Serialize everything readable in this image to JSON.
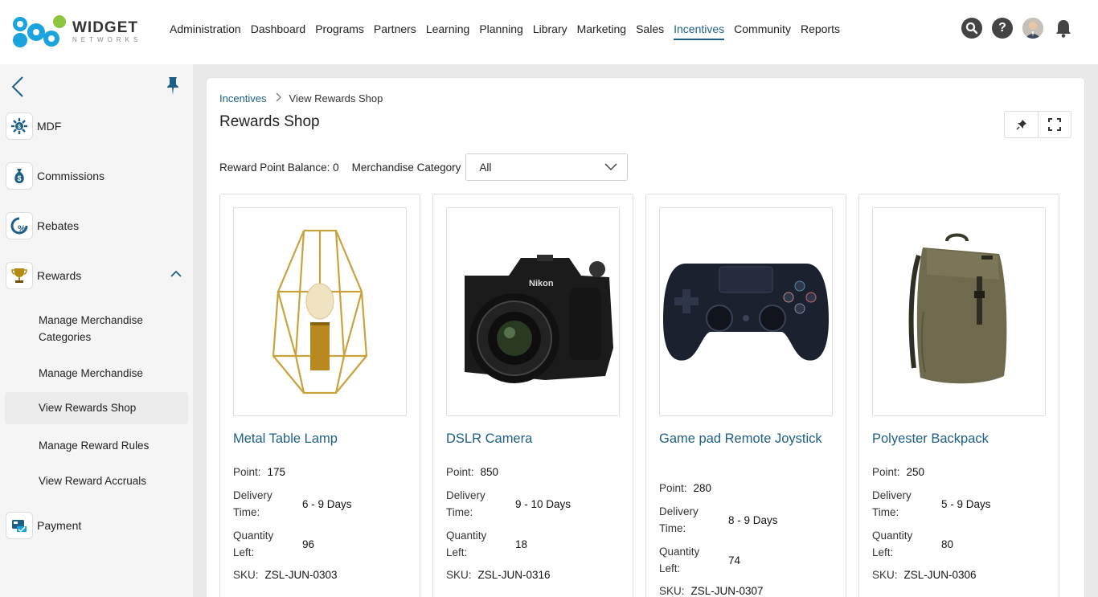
{
  "app": {
    "logo_word": "WIDGET",
    "logo_sub": "NETWORKS",
    "brand_colors": {
      "blue": "#1aa3dd",
      "green": "#8cc63f",
      "accent": "#1d5f85"
    }
  },
  "nav": {
    "items": [
      {
        "label": "Administration"
      },
      {
        "label": "Dashboard"
      },
      {
        "label": "Programs"
      },
      {
        "label": "Partners"
      },
      {
        "label": "Learning"
      },
      {
        "label": "Planning"
      },
      {
        "label": "Library"
      },
      {
        "label": "Marketing"
      },
      {
        "label": "Sales"
      },
      {
        "label": "Incentives",
        "active": true
      },
      {
        "label": "Community"
      },
      {
        "label": "Reports"
      }
    ],
    "icons": [
      "search-icon",
      "help-icon",
      "avatar",
      "bell-icon"
    ]
  },
  "sidebar": {
    "items": [
      {
        "label": "MDF",
        "icon": "mdf-icon"
      },
      {
        "label": "Commissions",
        "icon": "money-bag-icon"
      },
      {
        "label": "Rebates",
        "icon": "percent-icon"
      },
      {
        "label": "Rewards",
        "icon": "trophy-icon",
        "expanded": true
      },
      {
        "label": "Payment",
        "icon": "payment-icon"
      }
    ],
    "subitems": [
      {
        "label": "Manage Merchandise Categories"
      },
      {
        "label": "Manage Merchandise"
      },
      {
        "label": "View Rewards Shop",
        "active": true
      },
      {
        "label": "Manage Reward Rules"
      },
      {
        "label": "View Reward Accruals"
      }
    ]
  },
  "main": {
    "breadcrumb": {
      "link": "Incentives",
      "current": "View Rewards Shop"
    },
    "title": "Rewards Shop",
    "balance_label": "Reward Point Balance: 0",
    "category_label": "Merchandise Category",
    "category_value": "All",
    "field_labels": {
      "point": "Point:",
      "delivery_1": "Delivery",
      "delivery_2": "Time:",
      "quantity_1": "Quantity",
      "quantity_2": "Left:",
      "sku": "SKU:"
    },
    "products": [
      {
        "name": "Metal Table Lamp",
        "point": "175",
        "delivery": "6 - 9 Days",
        "quantity": "96",
        "sku": "ZSL-JUN-0303"
      },
      {
        "name": "DSLR Camera",
        "point": "850",
        "delivery": "9 - 10 Days",
        "quantity": "18",
        "sku": "ZSL-JUN-0316"
      },
      {
        "name": "Game pad Remote Joystick",
        "point": "280",
        "delivery": "8 - 9 Days",
        "quantity": "74",
        "sku": "ZSL-JUN-0307"
      },
      {
        "name": "Polyester Backpack",
        "point": "250",
        "delivery": "5 - 9 Days",
        "quantity": "80",
        "sku": "ZSL-JUN-0306"
      }
    ]
  }
}
